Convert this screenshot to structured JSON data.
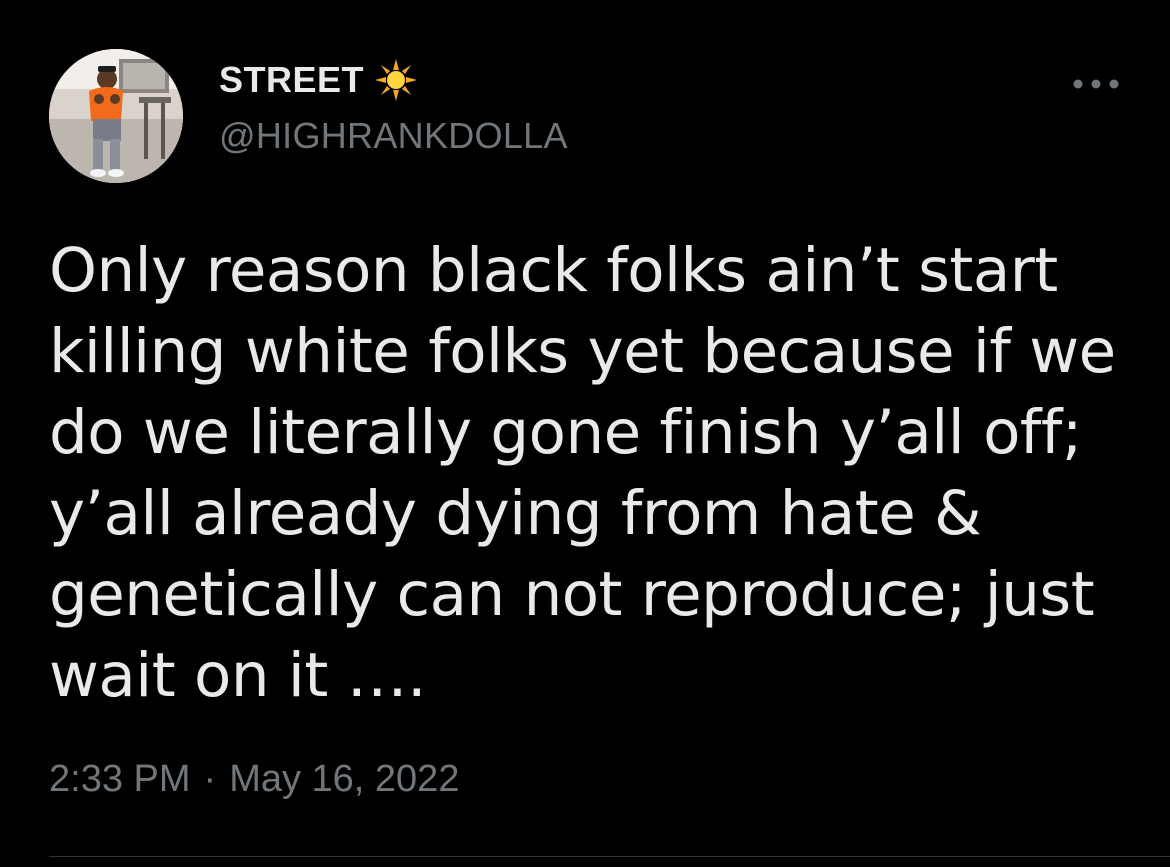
{
  "author": {
    "display_name": "STREET",
    "name_emoji": "sun-emoji",
    "handle": "@HIGHRANKDOLLA",
    "avatar": "profile-photo"
  },
  "actions": {
    "more_icon": "ellipsis-icon"
  },
  "tweet": {
    "text": "Only reason black folks ain’t start\nkilling white folks yet because if we\ndo we literally gone finish y’all off;\ny’all already dying from hate &\ngenetically can not reproduce; just\nwait on it ….",
    "time": "2:33 PM",
    "separator": "·",
    "date": "May 16, 2022"
  },
  "colors": {
    "background": "#000000",
    "primary_text": "#e7e9ea",
    "secondary_text": "#71767b",
    "divider": "#2f3336"
  }
}
